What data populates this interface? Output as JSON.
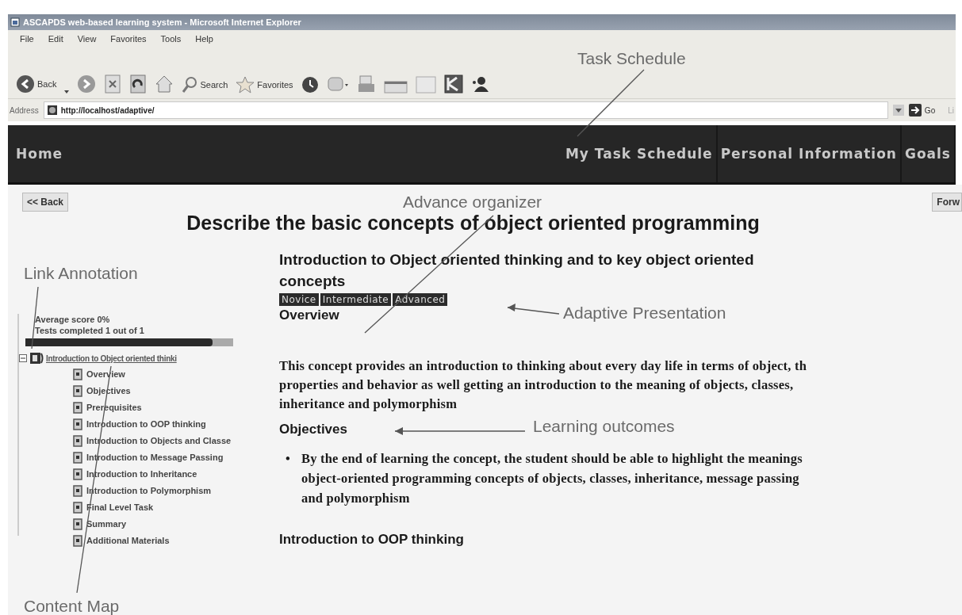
{
  "window": {
    "title": "ASCAPDS web-based learning system - Microsoft Internet Explorer"
  },
  "menu": [
    "File",
    "Edit",
    "View",
    "Favorites",
    "Tools",
    "Help"
  ],
  "toolbar": {
    "back": "Back",
    "search": "Search",
    "favorites": "Favorites"
  },
  "address": {
    "label": "Address",
    "value": "http://localhost/adaptive/",
    "go": "Go",
    "links": "Li"
  },
  "site_nav": {
    "home": "Home",
    "items": [
      "My Task Schedule",
      "Personal Information",
      "Goals"
    ]
  },
  "back_button": "<< Back",
  "forward_button": "Forw",
  "page_title": "Describe the basic concepts of object oriented programming",
  "sidebar": {
    "stats": [
      "Average score 0%",
      "Tests completed 1 out of 1"
    ],
    "progress": {
      "level": 0.9
    },
    "tree": {
      "label": "Introduction to Object oriented thinki",
      "expanded": true,
      "children": [
        {
          "label": "Overview"
        },
        {
          "label": "Objectives"
        },
        {
          "label": "Prerequisites"
        },
        {
          "label": "Introduction to OOP thinking"
        },
        {
          "label": "Introduction to Objects and Classe"
        },
        {
          "label": "Introduction to Message Passing"
        },
        {
          "label": "Introduction to Inheritance"
        },
        {
          "label": "Introduction to Polymorphism"
        },
        {
          "label": "Final Level Task"
        },
        {
          "label": "Summary"
        },
        {
          "label": "Additional Materials"
        }
      ]
    }
  },
  "content": {
    "heading": "Introduction to Object oriented thinking and to key object oriented concepts",
    "levels": [
      {
        "label": "Novice"
      },
      {
        "label": "Intermediate"
      },
      {
        "label": "Advanced"
      }
    ],
    "sections": [
      {
        "kind": "heading",
        "text": "Overview"
      },
      {
        "kind": "paragraph",
        "lines": [
          "This concept provides an introduction to thinking about every day life in terms of object, th",
          "properties and behavior as well getting an introduction to the meaning of objects, classes,",
          "inheritance and polymorphism"
        ]
      },
      {
        "kind": "heading",
        "text": "Objectives"
      },
      {
        "kind": "bullet",
        "marker": "•",
        "lines": [
          "By the end of learning the concept, the student should be able to highlight the meanings",
          "object-oriented programming concepts of objects, classes, inheritance, message passing",
          "and  polymorphism"
        ]
      },
      {
        "kind": "heading",
        "text": "Introduction to OOP thinking"
      }
    ]
  },
  "annotations": [
    {
      "label": "Task Schedule"
    },
    {
      "label": "Advance organizer"
    },
    {
      "label": "Link Annotation"
    },
    {
      "label": "Adaptive Presentation"
    },
    {
      "label": "Learning outcomes"
    },
    {
      "label": "Content Map"
    }
  ]
}
